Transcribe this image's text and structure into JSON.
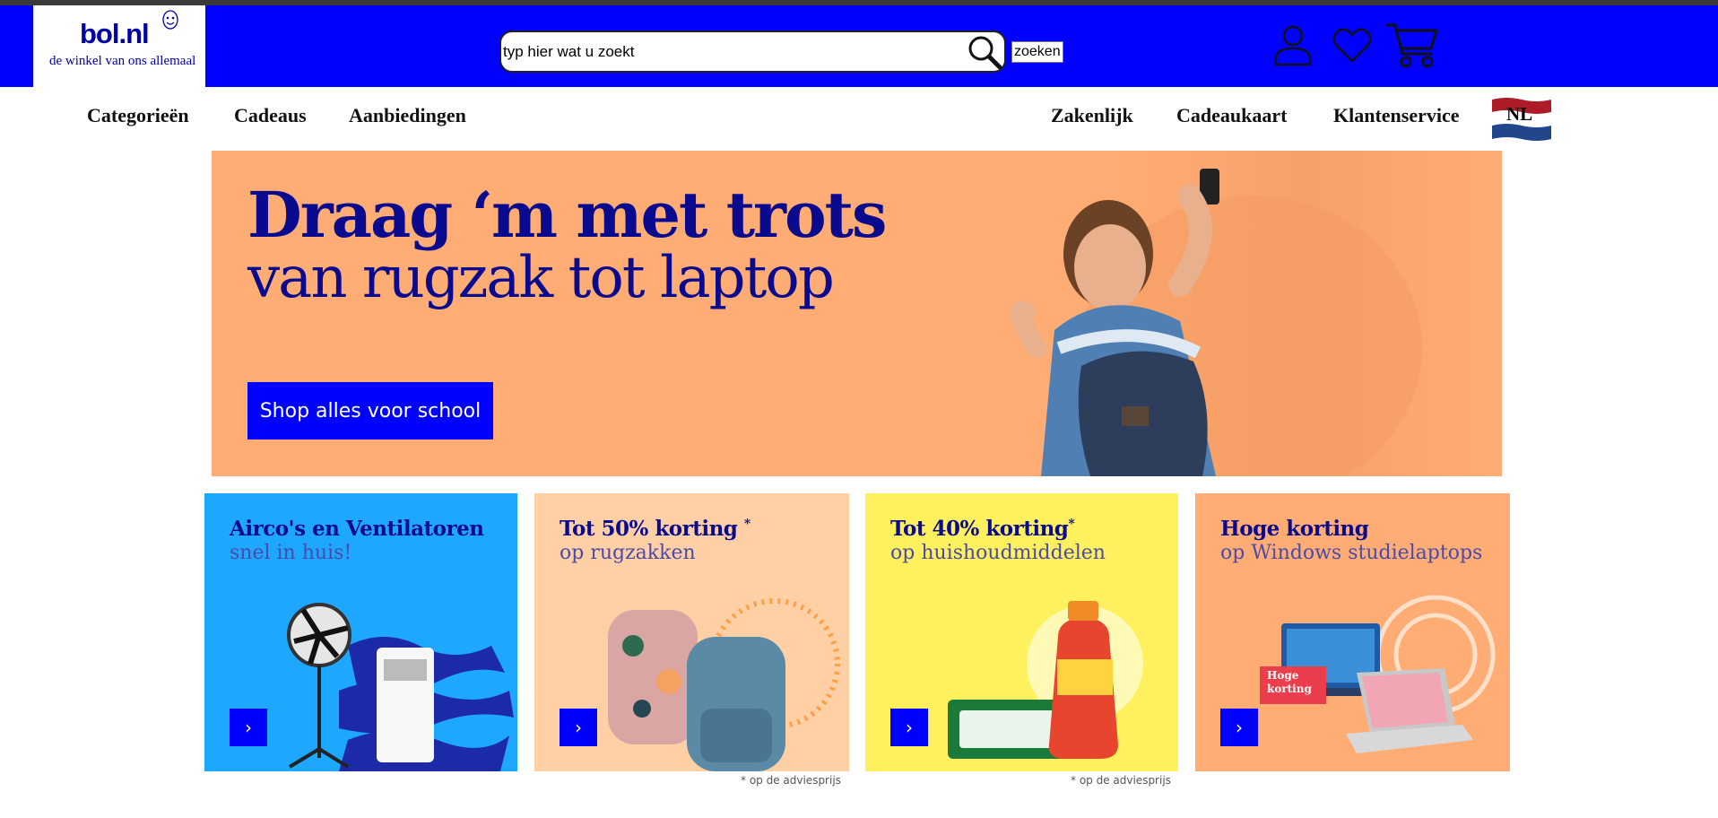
{
  "header": {
    "logo": {
      "name": "bol.nl",
      "tagline": "de winkel van ons allemaal"
    },
    "search": {
      "placeholder": "typ hier wat u zoekt",
      "value": "",
      "button_label": "zoeken"
    },
    "icons": [
      "user-icon",
      "heart-icon",
      "cart-icon"
    ],
    "colors": {
      "bar": "#0000ff",
      "logo_text": "#0000a4"
    }
  },
  "nav": {
    "left": [
      "Categorieën",
      "Cadeaus",
      "Aanbiedingen"
    ],
    "right": [
      "Zakenlijk",
      "Cadeaukaart",
      "Klantenservice"
    ],
    "language": "NL"
  },
  "hero": {
    "title": "Draag ‘m met trots",
    "subtitle": "van rugzak tot laptop",
    "cta": "Shop alles voor school",
    "background": "#ffad74"
  },
  "tiles": [
    {
      "title": "Airco's en Ventilatoren",
      "subtitle": "snel in huis!",
      "background": "#1ea7ff",
      "arrow": "›"
    },
    {
      "title": "Tot 50% korting",
      "title_mark": "*",
      "subtitle": "op rugzakken",
      "background": "#ffcfa6",
      "arrow": "›"
    },
    {
      "title": "Tot 40% korting",
      "title_mark": "*",
      "subtitle": "op huishoudmiddelen",
      "background": "#fff15e",
      "arrow": "›"
    },
    {
      "title": "Hoge korting",
      "subtitle": "op Windows studielaptops",
      "background": "#ffad74",
      "arrow": "›",
      "badge": [
        "Hoge",
        "korting"
      ]
    }
  ],
  "notes": [
    "* op de adviesprijs",
    "* op de adviesprijs"
  ]
}
